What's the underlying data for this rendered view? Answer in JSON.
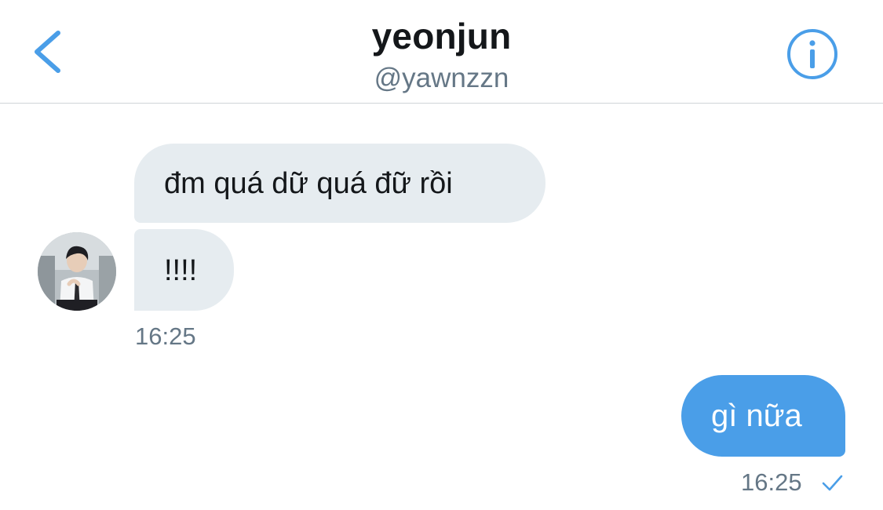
{
  "header": {
    "title": "yeonjun",
    "handle": "@yawnzzn",
    "back_icon": "chevron-left-icon",
    "info_icon": "info-circle-icon",
    "accent_color": "#4a9ee8"
  },
  "conversation": {
    "incoming": {
      "messages": [
        "đm quá dữ quá đữ rồi",
        "!!!!"
      ],
      "time": "16:25",
      "bubble_color": "#e6ecf0"
    },
    "outgoing": {
      "messages": [
        "gì nữa"
      ],
      "time": "16:25",
      "status_icon": "check-icon",
      "bubble_color": "#4a9ee8"
    }
  }
}
